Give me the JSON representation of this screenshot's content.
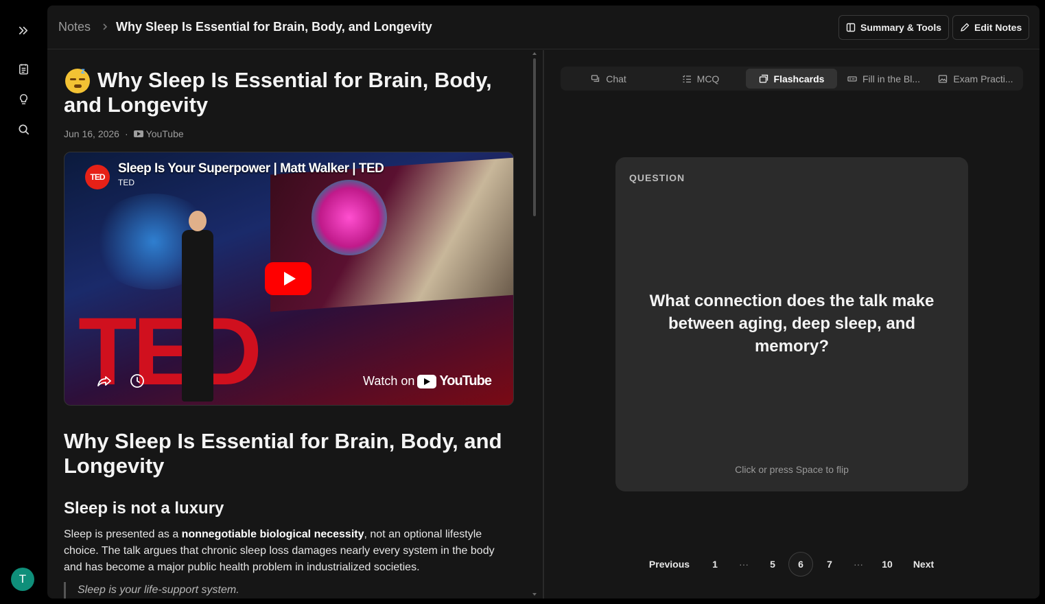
{
  "breadcrumb": {
    "root": "Notes",
    "current": "Why Sleep Is Essential for Brain, Body, and Longevity"
  },
  "toolbar": {
    "summary_label": "Summary & Tools",
    "edit_label": "Edit Notes"
  },
  "note": {
    "title": "Why Sleep Is Essential for Brain, Body, and Longevity",
    "date": "Jun 16, 2026",
    "separator": "·",
    "source": "YouTube",
    "emoji_sleep": "z",
    "video": {
      "title": "Sleep Is Your Superpower | Matt Walker | TED",
      "channel": "TED",
      "logo_text": "TED",
      "stage_text": "TED",
      "watch_prefix": "Watch on",
      "watch_brand": "YouTube"
    },
    "heading": "Why Sleep Is Essential for Brain, Body, and Longevity",
    "section_title": "Sleep is not a luxury",
    "paragraph_start": "Sleep is presented as a ",
    "paragraph_bold": "nonnegotiable biological necessity",
    "paragraph_end": ", not an optional lifestyle choice. The talk argues that chronic sleep loss damages nearly every system in the body and has become a major public health problem in industrialized societies.",
    "quote": "Sleep is your life-support system."
  },
  "tabs": [
    {
      "label": "Chat",
      "icon": "chat-icon"
    },
    {
      "label": "MCQ",
      "icon": "list-icon"
    },
    {
      "label": "Flashcards",
      "icon": "cards-icon",
      "active": true
    },
    {
      "label": "Fill in the Bl...",
      "icon": "blank-icon"
    },
    {
      "label": "Exam Practi...",
      "icon": "image-icon"
    }
  ],
  "flashcard": {
    "label": "QUESTION",
    "question": "What connection does the talk make between aging, deep sleep, and memory?",
    "hint": "Click or press Space to flip"
  },
  "pagination": {
    "previous": "Previous",
    "next": "Next",
    "ellipsis": "···",
    "pages": [
      "1",
      "5",
      "6",
      "7",
      "10"
    ],
    "current": "6"
  },
  "user": {
    "avatar_initial": "T"
  },
  "colors": {
    "accent_avatar": "#0f8f7a",
    "youtube_red": "#ff0000",
    "ted_red": "#e62117"
  }
}
